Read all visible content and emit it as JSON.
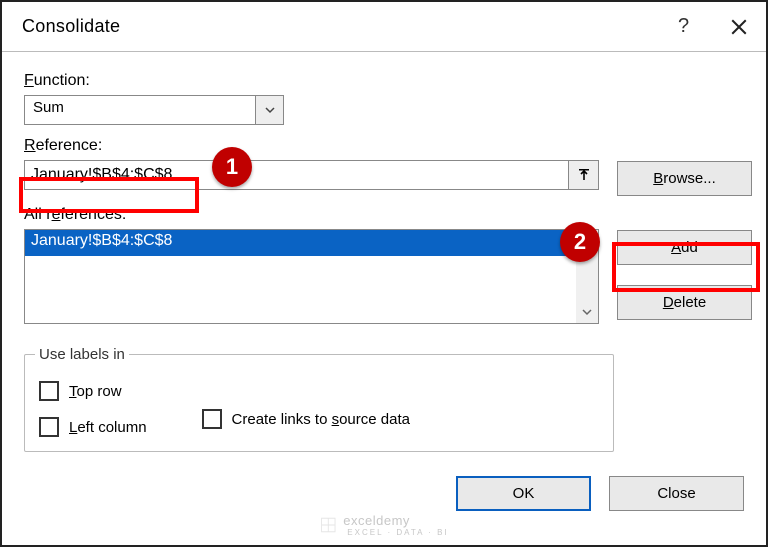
{
  "dialog": {
    "title": "Consolidate",
    "help_symbol": "?"
  },
  "labels": {
    "function": "unction:",
    "function_u": "F",
    "reference": "eference:",
    "reference_u": "R",
    "all_references": "All r",
    "all_references_after": "ferences:",
    "all_references_u": "e"
  },
  "function": {
    "value": "Sum"
  },
  "reference": {
    "value": "January!$B$4:$C$8"
  },
  "all_references": {
    "items": [
      "January!$B$4:$C$8"
    ]
  },
  "buttons": {
    "browse": "rowse...",
    "browse_u": "B",
    "add": "dd",
    "add_u": "A",
    "delete": "elete",
    "delete_u": "D",
    "ok": "OK",
    "close": "Close"
  },
  "fieldset": {
    "legend": "Use labels in",
    "top_row": "op row",
    "top_row_u": "T",
    "left_col": "eft column",
    "left_col_u": "L",
    "create_links_before": "Create links to ",
    "create_links_u": "s",
    "create_links_after": "ource data"
  },
  "callouts": {
    "one": "1",
    "two": "2"
  },
  "watermark": {
    "brand": "exceldemy",
    "sub": "EXCEL · DATA · BI"
  }
}
